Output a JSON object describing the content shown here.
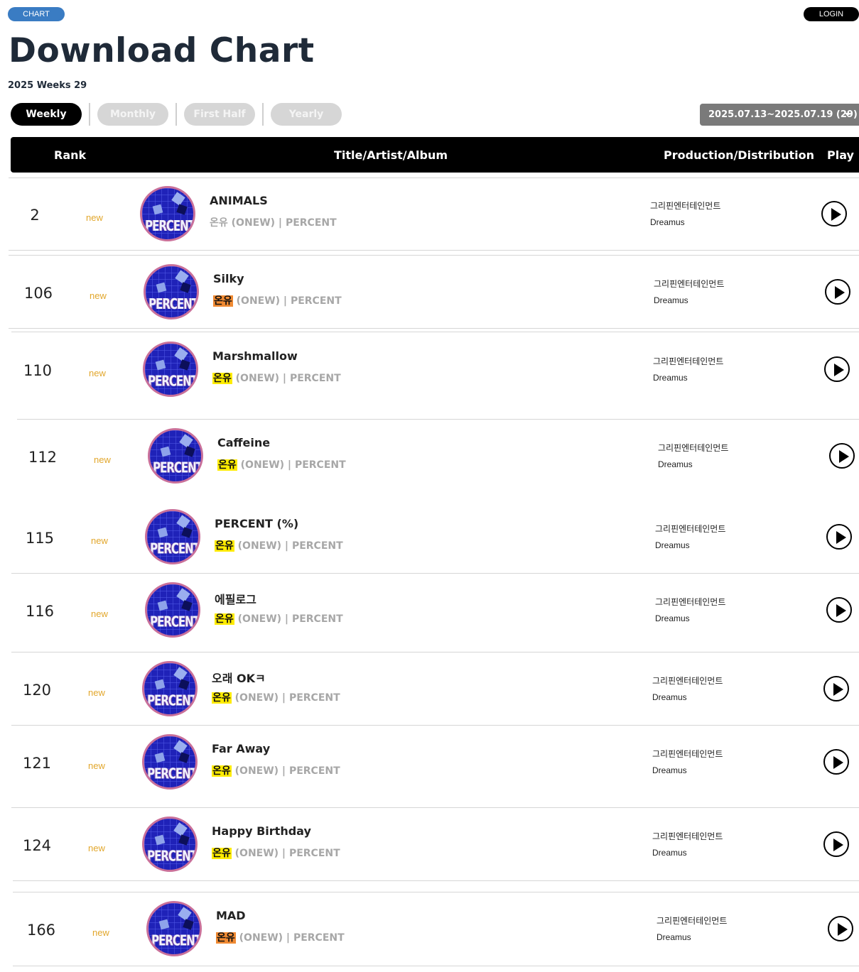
{
  "header": {
    "chart_chip": "CHART",
    "login_label": "LOGIN",
    "title": "Download Chart",
    "subtitle": "2025 Weeks 29"
  },
  "tabs": [
    {
      "label": "Weekly",
      "active": true
    },
    {
      "label": "Monthly",
      "active": false
    },
    {
      "label": "First Half",
      "active": false
    },
    {
      "label": "Yearly",
      "active": false
    }
  ],
  "period_select": {
    "value": "2025.07.13~2025.07.19 (29)"
  },
  "table": {
    "columns": {
      "rank": "Rank",
      "title": "Title/Artist/Album",
      "production": "Production/Distribution",
      "play": "Play"
    }
  },
  "cover_word": "PERCENT",
  "colors": {
    "highlight_orange": "#f08a33",
    "highlight_yellow": "#ffec00",
    "new_badge": "#e2a72c",
    "chip_blue": "#3a7cc3"
  },
  "rows": [
    {
      "rank": "2",
      "badge": "new",
      "title": "ANIMALS",
      "artist": "온유",
      "artist_rest": "(ONEW)",
      "album": "PERCENT",
      "highlight": "none",
      "production": "그리핀엔터테인먼트",
      "distribution": "Dreamus"
    },
    {
      "rank": "106",
      "badge": "new",
      "title": "Silky",
      "artist": "온유",
      "artist_rest": "(ONEW)",
      "album": "PERCENT",
      "highlight": "orange",
      "production": "그리핀엔터테인먼트",
      "distribution": "Dreamus"
    },
    {
      "rank": "110",
      "badge": "new",
      "title": "Marshmallow",
      "artist": "온유",
      "artist_rest": "(ONEW)",
      "album": "PERCENT",
      "highlight": "yellow",
      "production": "그리핀엔터테인먼트",
      "distribution": "Dreamus"
    },
    {
      "rank": "112",
      "badge": "new",
      "title": "Caffeine",
      "artist": "온유",
      "artist_rest": "(ONEW)",
      "album": "PERCENT",
      "highlight": "yellow",
      "production": "그리핀엔터테인먼트",
      "distribution": "Dreamus"
    },
    {
      "rank": "115",
      "badge": "new",
      "title": "PERCENT (%)",
      "artist": "온유",
      "artist_rest": "(ONEW)",
      "album": "PERCENT",
      "highlight": "yellow",
      "production": "그리핀엔터테인먼트",
      "distribution": "Dreamus"
    },
    {
      "rank": "116",
      "badge": "new",
      "title": "에필로그",
      "artist": "온유",
      "artist_rest": "(ONEW)",
      "album": "PERCENT",
      "highlight": "yellow",
      "production": "그리핀엔터테인먼트",
      "distribution": "Dreamus"
    },
    {
      "rank": "120",
      "badge": "new",
      "title": "오래 OKㅋ",
      "artist": "온유",
      "artist_rest": "(ONEW)",
      "album": "PERCENT",
      "highlight": "yellow",
      "production": "그리핀엔터테인먼트",
      "distribution": "Dreamus"
    },
    {
      "rank": "121",
      "badge": "new",
      "title": "Far Away",
      "artist": "온유",
      "artist_rest": "(ONEW)",
      "album": "PERCENT",
      "highlight": "yellow",
      "production": "그리핀엔터테인먼트",
      "distribution": "Dreamus"
    },
    {
      "rank": "124",
      "badge": "new",
      "title": "Happy Birthday",
      "artist": "온유",
      "artist_rest": "(ONEW)",
      "album": "PERCENT",
      "highlight": "yellow",
      "production": "그리핀엔터테인먼트",
      "distribution": "Dreamus"
    },
    {
      "rank": "166",
      "badge": "new",
      "title": "MAD",
      "artist": "온유",
      "artist_rest": "(ONEW)",
      "album": "PERCENT",
      "highlight": "orange",
      "production": "그리핀엔터테인먼트",
      "distribution": "Dreamus"
    }
  ]
}
